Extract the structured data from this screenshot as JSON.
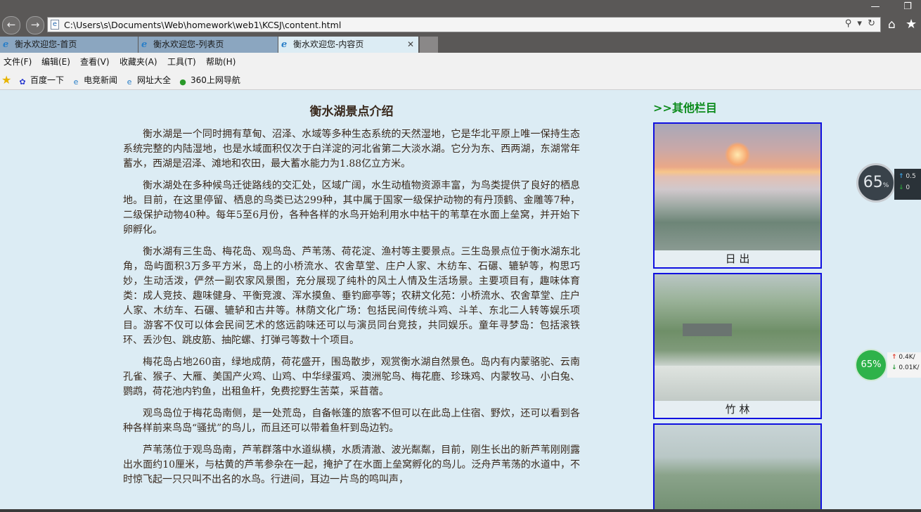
{
  "browser": {
    "address_url": "C:\\Users\\s\\Documents\\Web\\homework\\web1\\KCSJ\\content.html",
    "address_tools": "⚲ ▾ ↻",
    "tabs": [
      {
        "label": "衡水欢迎您-首页"
      },
      {
        "label": "衡水欢迎您-列表页"
      },
      {
        "label": "衡水欢迎您-内容页"
      }
    ],
    "menu": [
      "文件(F)",
      "编辑(E)",
      "查看(V)",
      "收藏夹(A)",
      "工具(T)",
      "帮助(H)"
    ],
    "favorites": [
      "百度一下",
      "电竞新闻",
      "网址大全",
      "360上网导航"
    ],
    "icons": {
      "back": "arrow-left-icon",
      "forward": "arrow-right-icon",
      "home": "home-icon",
      "favorites": "star-icon"
    }
  },
  "article": {
    "title": "衡水湖景点介绍",
    "paragraphs": [
      "衡水湖是一个同时拥有草甸、沼泽、水域等多种生态系统的天然湿地，它是华北平原上唯一保持生态系统完整的内陆湿地，也是水域面积仅次于白洋淀的河北省第二大淡水湖。它分为东、西两湖，东湖常年蓄水，西湖是沼泽、滩地和农田，最大蓄水能力为1.88亿立方米。",
      "衡水湖处在多种候鸟迁徙路线的交汇处，区域广阔，水生动植物资源丰富，为鸟类提供了良好的栖息地。目前，在这里停留、栖息的鸟类已达299种，其中属于国家一级保护动物的有丹顶鹤、金雕等7种，二级保护动物40种。每年5至6月份，各种各样的水鸟开始利用水中枯干的苇草在水面上垒窝，并开始下卵孵化。",
      "衡水湖有三生岛、梅花岛、观鸟岛、芦苇荡、荷花淀、渔村等主要景点。三生岛景点位于衡水湖东北角，岛屿面积3万多平方米，岛上的小桥流水、农舍草堂、庄户人家、木纺车、石碾、辘轳等，构思巧妙，生动活泼，俨然一副农家风景图，充分展现了纯朴的风土人情及生活场景。主要项目有，趣味体育类：成人竞技、趣味健身、平衡竞渡、浑水摸鱼、垂钓廊亭等；农耕文化苑：小桥流水、农舍草堂、庄户人家、木纺车、石碾、辘轳和古井等。林荫文化广场：包括民间传统斗鸡、斗羊、东北二人转等娱乐项目。游客不仅可以体会民间艺术的悠远韵味还可以与演员同台竞技，共同娱乐。童年寻梦岛：包括滚铁环、丢沙包、跳皮筋、抽陀螺、打弹弓等数十个项目。",
      "梅花岛占地260亩，绿地成荫，荷花盛开，围岛散步，观赏衡水湖自然景色。岛内有内蒙骆驼、云南孔雀、猴子、大雁、美国产火鸡、山鸡、中华绿蛋鸡、澳洲鸵鸟、梅花鹿、珍珠鸡、内蒙牧马、小白兔、鹦鹉，荷花池内钓鱼，出租鱼杆，免费挖野生苦菜，采苜蓿。",
      "观鸟岛位于梅花岛南侧，是一处荒岛，自备帐篷的旅客不但可以在此岛上住宿、野炊，还可以看到各种各样前来鸟岛“骚扰”的鸟儿，而且还可以带着鱼杆到岛边钓。",
      "芦苇荡位于观鸟岛南，芦苇群落中水道纵横，水质清澈、波光粼粼，目前，刚生长出的新芦苇刚刚露出水面约10厘米，与枯黄的芦苇参杂在一起，掩护了在水面上垒窝孵化的鸟儿。泛舟芦苇荡的水道中，不时惊飞起一只只叫不出名的水鸟。行进间，耳边一片鸟的鸣叫声，"
    ]
  },
  "sidebar": {
    "title": ">>其他栏目",
    "cards": [
      {
        "caption": "日 出"
      },
      {
        "caption": "竹 林"
      },
      {
        "caption": ""
      }
    ]
  },
  "widgets": {
    "widget1": {
      "percent": "65",
      "unit": "%",
      "up": "0.5",
      "down": "0"
    },
    "widget2": {
      "percent": "65%",
      "up": "0.4K/",
      "down": "0.01K/"
    }
  }
}
